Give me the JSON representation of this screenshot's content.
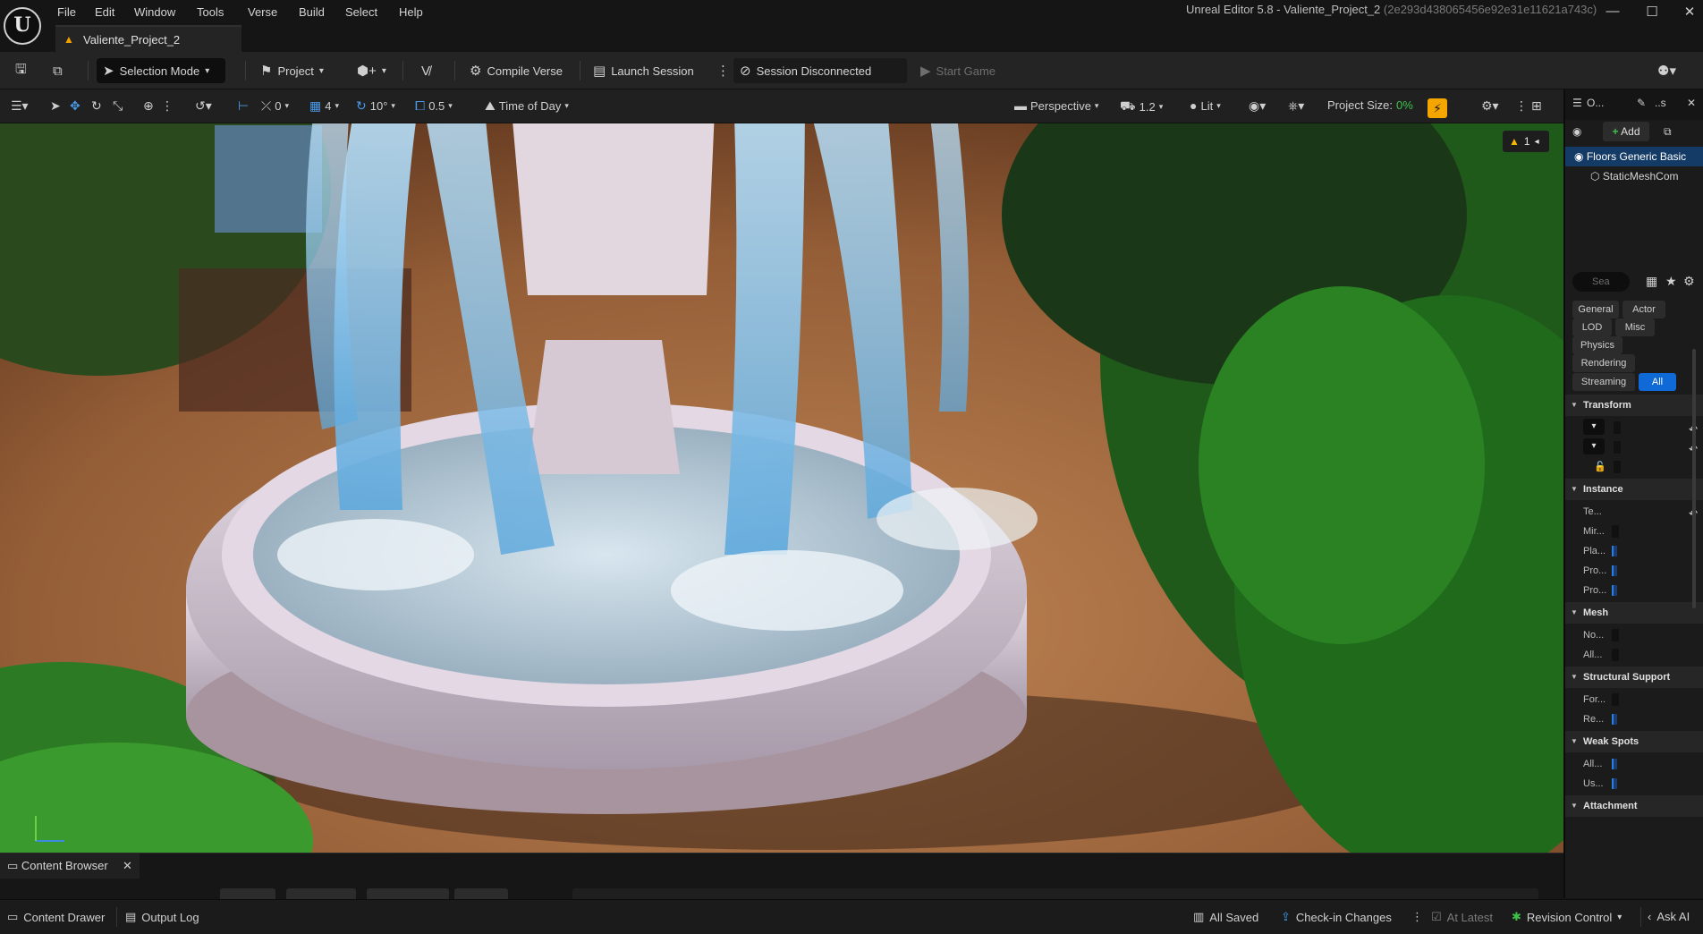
{
  "app": {
    "logo_text": "U",
    "window_title": "Unreal Editor 5.8 - Valiente_Project_2",
    "window_hash": "(2e293d438065456e92e31e11621a743c)"
  },
  "menu": [
    "File",
    "Edit",
    "Window",
    "Tools",
    "Verse",
    "Build",
    "Select",
    "Help"
  ],
  "document_tab": "Valiente_Project_2",
  "toolbar": {
    "selection_mode": "Selection Mode",
    "project": "Project",
    "compile_verse": "Compile Verse",
    "launch_session": "Launch Session",
    "session_status": "Session Disconnected",
    "start_game": "Start Game"
  },
  "viewport_toolbar": {
    "rotation_snap": "0",
    "grid_snap": "4",
    "angle_snap": "10°",
    "scale_snap": "0.5",
    "time_of_day": "Time of Day",
    "perspective": "Perspective",
    "camera_speed": "1.2",
    "view_mode": "Lit",
    "project_size_label": "Project Size:",
    "project_size_value": "0%",
    "warning_count": "1"
  },
  "outliner": {
    "tab_label": "O...",
    "details_tab_label": "..s",
    "add_button": "Add",
    "items": [
      "Floors Generic Basic",
      "StaticMeshCom"
    ]
  },
  "details": {
    "search_placeholder": "Sea",
    "filters": [
      "General",
      "Actor",
      "LOD",
      "Misc",
      "Physics",
      "Rendering",
      "Streaming",
      "All"
    ],
    "categories": {
      "transform": "Transform",
      "instance": "Instance",
      "mesh": "Mesh",
      "structural_support": "Structural Support",
      "weak_spots": "Weak Spots",
      "attachment": "Attachment"
    },
    "instance_props": [
      "Te...",
      "Mir...",
      "Pla...",
      "Pro...",
      "Pro..."
    ],
    "mesh_props": [
      "No...",
      "All..."
    ],
    "structural_props": [
      "For...",
      "Re..."
    ],
    "weak_spot_props": [
      "All...",
      "Us..."
    ]
  },
  "content_browser": {
    "tab_label": "Content Browser"
  },
  "statusbar": {
    "content_drawer": "Content Drawer",
    "output_log": "Output Log",
    "all_saved": "All Saved",
    "check_in": "Check-in Changes",
    "at_latest": "At Latest",
    "revision_control": "Revision Control",
    "ask_ai": "Ask AI"
  },
  "colors": {
    "accent_blue": "#0f6ad8",
    "realtime_orange": "#f5a500",
    "warning_yellow": "#f5b500",
    "project_size_green": "#3ec24a"
  }
}
